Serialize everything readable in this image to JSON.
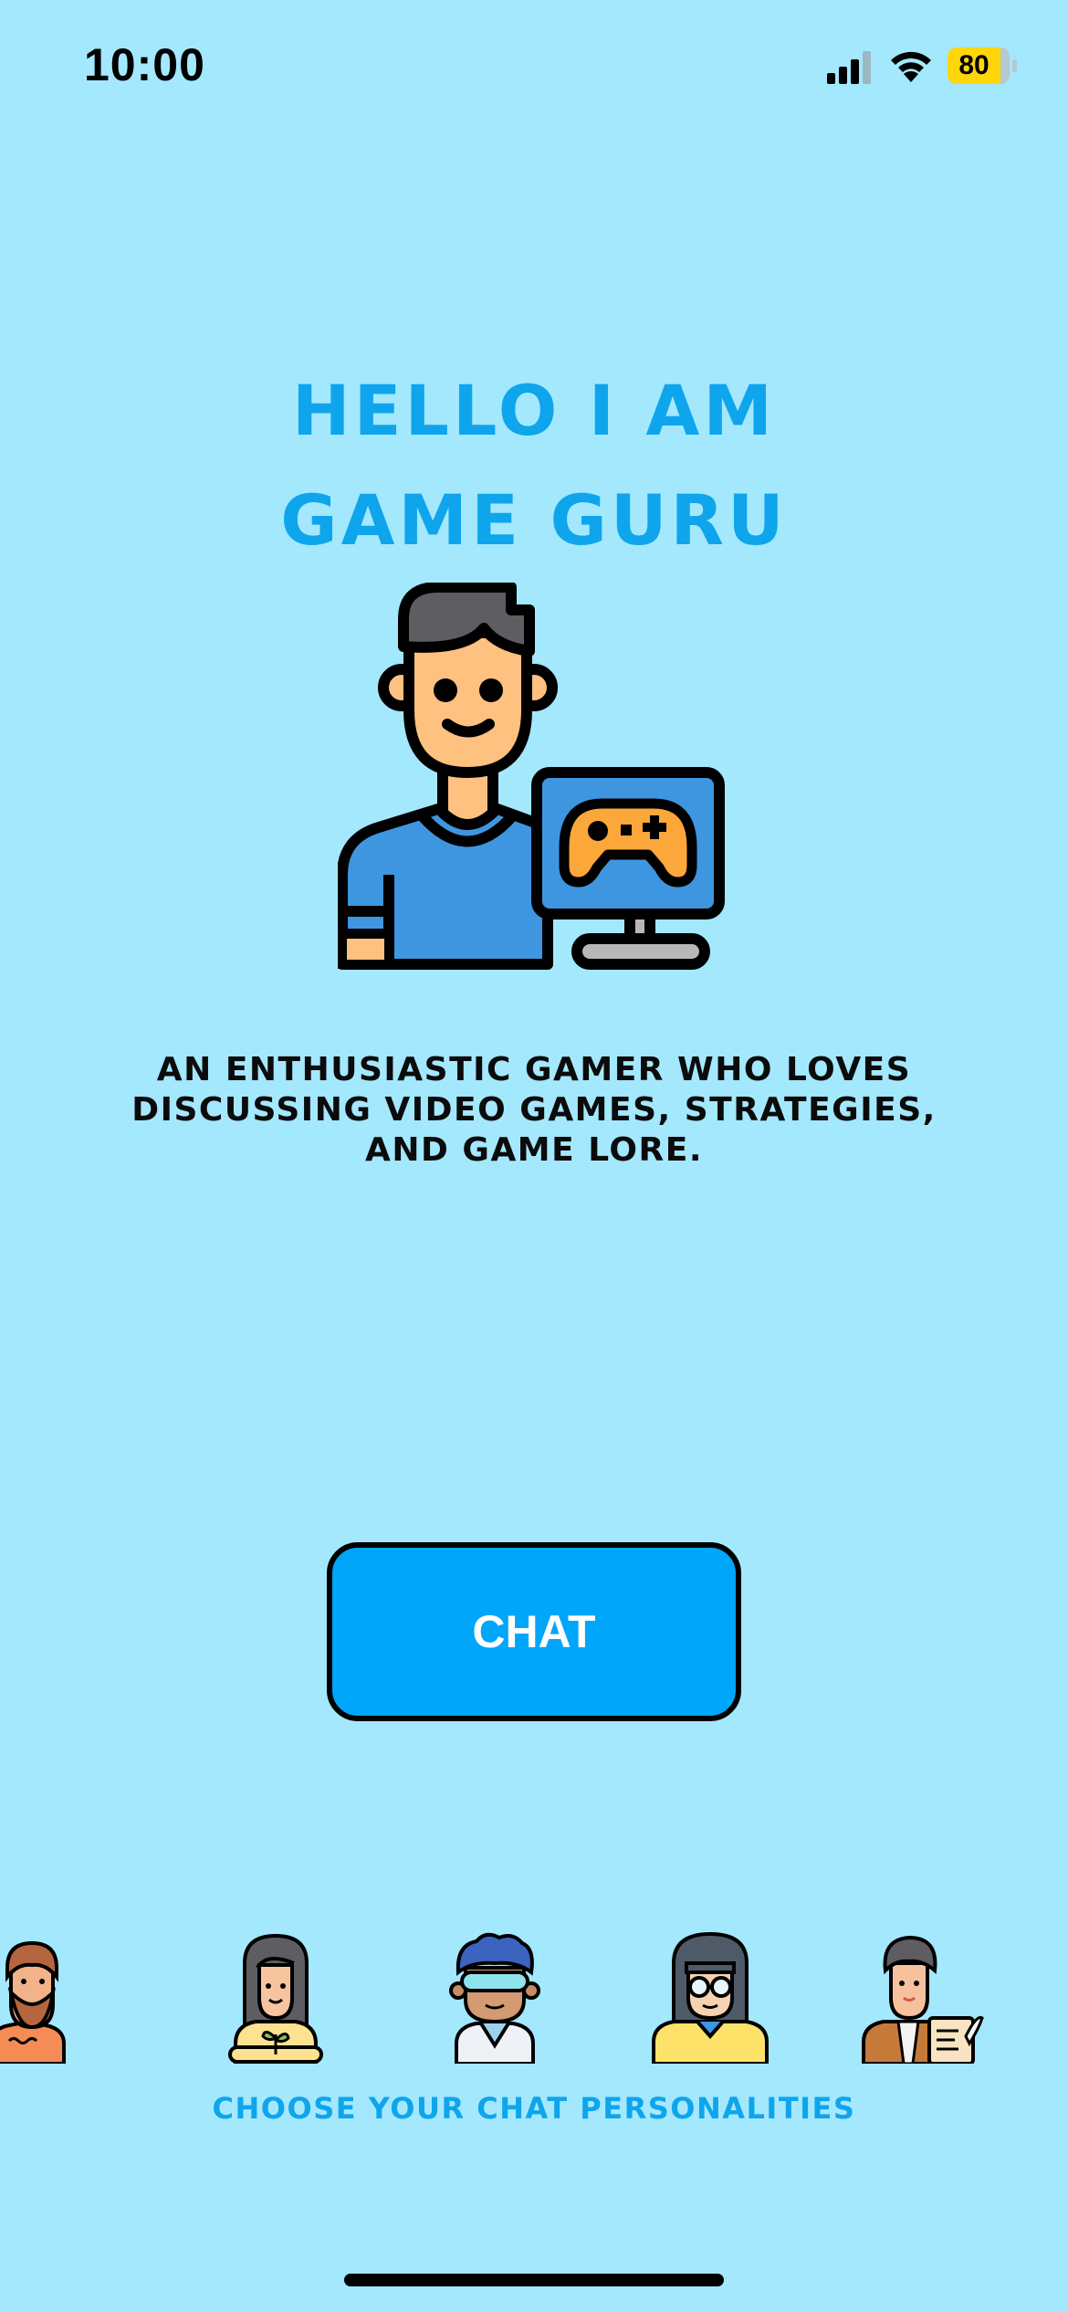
{
  "status_bar": {
    "time": "10:00",
    "battery_level": "80",
    "icons": [
      "signal-icon",
      "wifi-icon",
      "battery-icon"
    ]
  },
  "header": {
    "title_line1": "HELLO I AM",
    "title_line2": "GAME GURU"
  },
  "hero": {
    "icon": "gamer-avatar-icon"
  },
  "description": "AN ENTHUSIASTIC GAMER WHO LOVES DISCUSSING VIDEO GAMES, STRATEGIES, AND GAME LORE.",
  "chat_button": {
    "label": "CHAT"
  },
  "personalities": {
    "label": "CHOOSE YOUR CHAT PERSONALITIES",
    "avatars": [
      "bearded-man-avatar-icon",
      "gardener-avatar-icon",
      "scientist-avatar-icon",
      "glasses-woman-avatar-icon",
      "writer-avatar-icon"
    ]
  },
  "colors": {
    "background": "#a4e8fe",
    "accent": "#0ea5ec",
    "button": "#00a6fa"
  }
}
